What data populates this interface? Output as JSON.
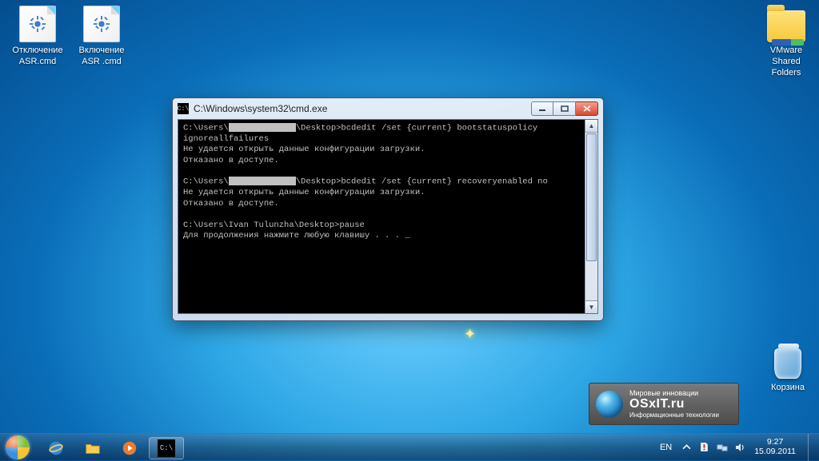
{
  "desktop_icons": {
    "icon1_label": "Отключение ASR.cmd",
    "icon2_label": "Включение ASR .cmd",
    "icon3_label": "VMware Shared Folders",
    "recycle_label": "Корзина"
  },
  "cmd_window": {
    "title": "C:\\Windows\\system32\\cmd.exe",
    "line1_a": "C:\\Users\\",
    "line1_b": "\\Desktop>bcdedit /set {current} bootstatuspolicy ignoreallfailures",
    "line2": "Не удается открыть данные конфигурации загрузки.",
    "line3": "Отказано в доступе.",
    "line4_a": "C:\\Users\\",
    "line4_b": "\\Desktop>bcdedit /set {current} recoveryenabled no",
    "line5": "Не удается открыть данные конфигурации загрузки.",
    "line6": "Отказано в доступе.",
    "line7": "C:\\Users\\Ivan Tulunzha\\Desktop>pause",
    "line8": "Для продолжения нажмите любую клавишу . . . _"
  },
  "brand": {
    "line1": "Мировые инновации",
    "line2": "OSxIT.ru",
    "line3": "Информационные технологии"
  },
  "taskbar": {
    "lang": "EN",
    "time": "9:27",
    "date": "15.09.2011"
  }
}
